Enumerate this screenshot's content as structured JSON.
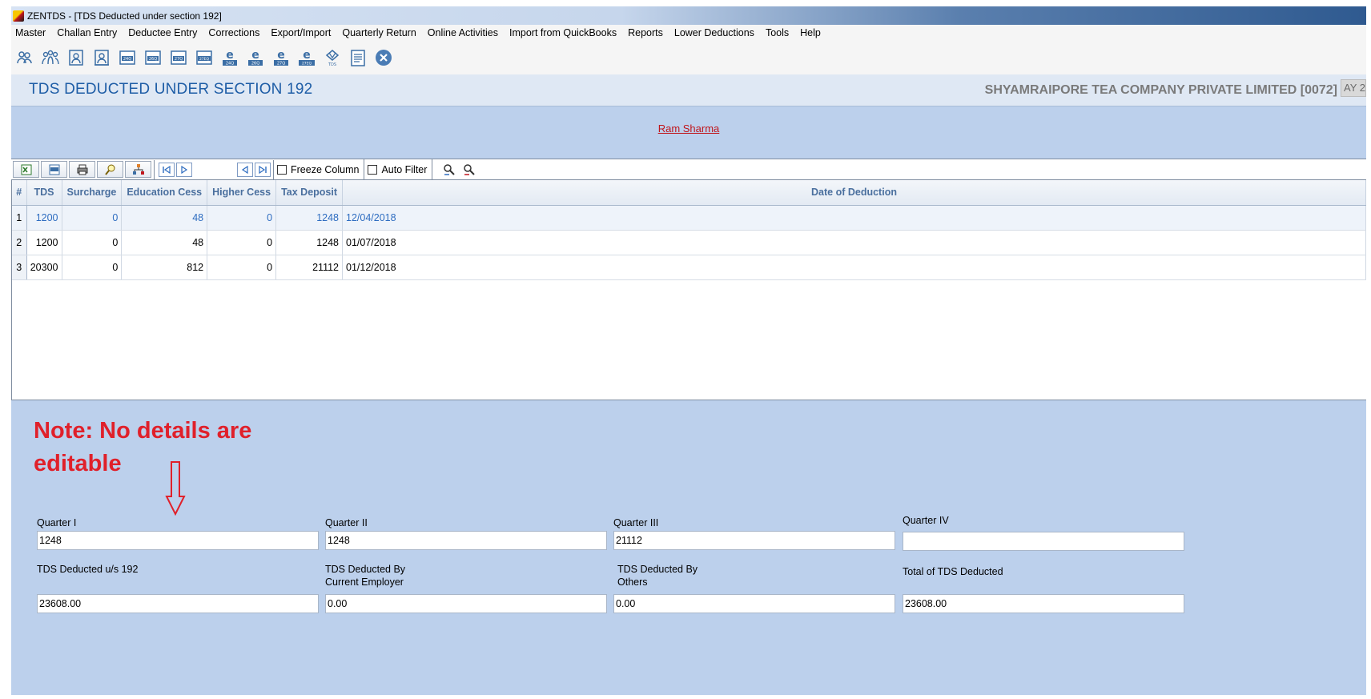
{
  "window": {
    "title": "ZENTDS - [TDS Deducted under section 192]"
  },
  "menu": [
    "Master",
    "Challan Entry",
    "Deductee Entry",
    "Corrections",
    "Export/Import",
    "Quarterly Return",
    "Online Activities",
    "Import from QuickBooks",
    "Reports",
    "Lower Deductions",
    "Tools",
    "Help"
  ],
  "toolbar_icons": [
    {
      "name": "users-icon"
    },
    {
      "name": "group-users-icon"
    },
    {
      "name": "person-card-icon"
    },
    {
      "name": "person-card-2-icon"
    },
    {
      "name": "form-24q-icon",
      "text": "24Q"
    },
    {
      "name": "form-26q-icon",
      "text": "26Q"
    },
    {
      "name": "form-27q-icon",
      "text": "27Q"
    },
    {
      "name": "form-27eq-icon",
      "text": "27EQ"
    },
    {
      "name": "efile-24q-icon",
      "text": "24Q"
    },
    {
      "name": "efile-26q-icon",
      "text": "26Q"
    },
    {
      "name": "efile-27q-icon",
      "text": "27Q"
    },
    {
      "name": "efile-27eq-icon",
      "text": "27EQ"
    },
    {
      "name": "tds-icon",
      "text": "TDS"
    },
    {
      "name": "document-icon"
    },
    {
      "name": "close-circle-icon"
    }
  ],
  "header": {
    "title": "TDS DEDUCTED UNDER SECTION 192",
    "company": "SHYAMRAIPORE TEA COMPANY PRIVATE LIMITED [0072]",
    "ay": "AY 2"
  },
  "deductee_name": "Ram Sharma",
  "grid_toolbar": {
    "freeze_label": "Freeze Column",
    "autofilter_label": "Auto Filter"
  },
  "table": {
    "columns": [
      "#",
      "TDS",
      "Surcharge",
      "Education  Cess",
      "Higher Cess",
      "Tax Deposit",
      "Date of Deduction"
    ],
    "rows": [
      [
        "1",
        "1200",
        "0",
        "48",
        "0",
        "1248",
        "12/04/2018"
      ],
      [
        "2",
        "1200",
        "0",
        "48",
        "0",
        "1248",
        "01/07/2018"
      ],
      [
        "3",
        "20300",
        "0",
        "812",
        "0",
        "21112",
        "01/12/2018"
      ]
    ]
  },
  "note": {
    "line1": "Note: No details are",
    "line2": "editable"
  },
  "quarters": [
    {
      "label": "Quarter I",
      "value": "1248"
    },
    {
      "label": "Quarter II",
      "value": "1248"
    },
    {
      "label": "Quarter III",
      "value": "21112"
    },
    {
      "label": "Quarter IV",
      "value": ""
    }
  ],
  "totals": [
    {
      "label1": "TDS Deducted u/s 192",
      "label2": "",
      "value": "23608.00"
    },
    {
      "label1": "TDS Deducted By",
      "label2": "Current Employer",
      "value": "0.00"
    },
    {
      "label1": "TDS Deducted By",
      "label2": "Others",
      "value": "0.00"
    },
    {
      "label1": "Total of TDS Deducted",
      "label2": "",
      "value": "23608.00"
    }
  ],
  "colors": {
    "accent": "#1e5da6",
    "note": "#e0202a",
    "background": "#bcd0ec"
  }
}
